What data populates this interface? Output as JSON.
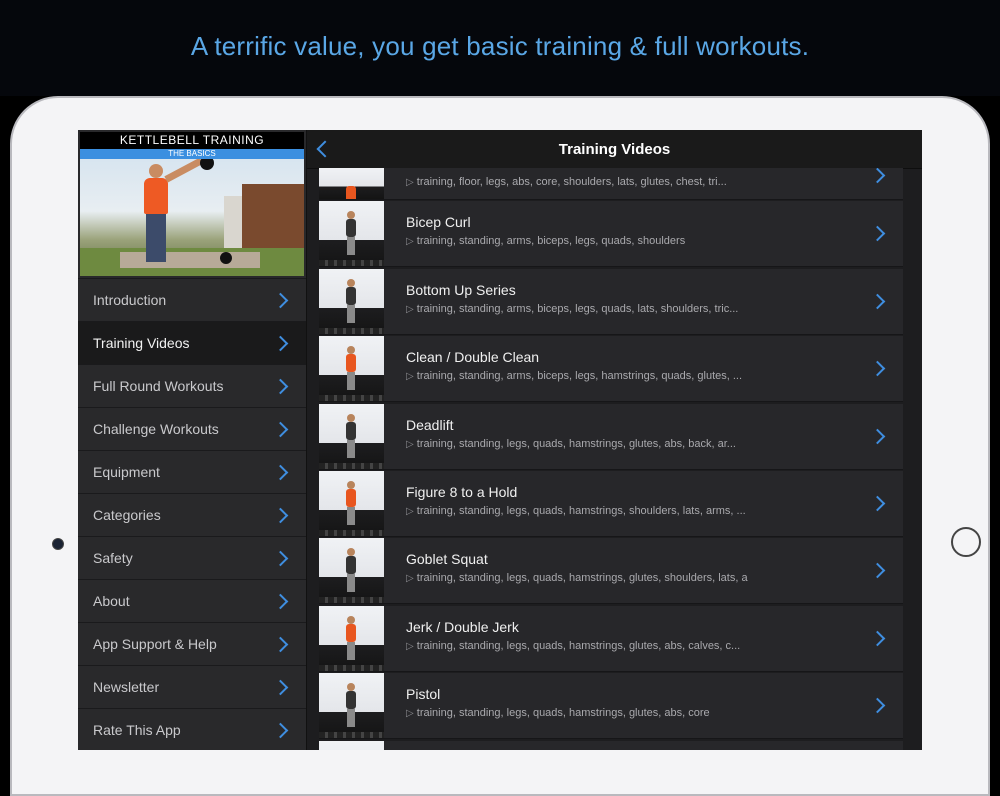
{
  "headline": "A terrific value, you get basic training & full workouts.",
  "app": {
    "hero_title": "KETTLEBELL TRAINING",
    "hero_subtitle": "THE BASICS"
  },
  "sidebar": {
    "items": [
      {
        "label": "Introduction"
      },
      {
        "label": "Training Videos",
        "active": true
      },
      {
        "label": "Full Round Workouts"
      },
      {
        "label": "Challenge Workouts"
      },
      {
        "label": "Equipment"
      },
      {
        "label": "Categories"
      },
      {
        "label": "Safety"
      },
      {
        "label": "About"
      },
      {
        "label": "App Support & Help"
      },
      {
        "label": "Newsletter"
      },
      {
        "label": "Rate This App"
      }
    ]
  },
  "nav": {
    "title": "Training Videos"
  },
  "videos": [
    {
      "title": "",
      "tags": "training, floor, legs, abs, core, shoulders, lats, glutes, chest, tri..."
    },
    {
      "title": "Bicep Curl",
      "tags": "training, standing, arms, biceps, legs, quads, shoulders"
    },
    {
      "title": "Bottom Up Series",
      "tags": "training, standing, arms, biceps, legs, quads, lats, shoulders, tric..."
    },
    {
      "title": "Clean / Double Clean",
      "tags": "training, standing, arms, biceps, legs, hamstrings, quads, glutes, ..."
    },
    {
      "title": "Deadlift",
      "tags": "training, standing, legs, quads, hamstrings, glutes, abs, back, ar..."
    },
    {
      "title": "Figure 8 to a Hold",
      "tags": "training, standing, legs, quads, hamstrings, shoulders, lats, arms, ..."
    },
    {
      "title": "Goblet Squat",
      "tags": "training, standing, legs, quads, hamstrings, glutes, shoulders, lats, a"
    },
    {
      "title": "Jerk / Double Jerk",
      "tags": "training, standing, legs, quads, hamstrings, glutes, abs, calves, c..."
    },
    {
      "title": "Pistol",
      "tags": "training, standing, legs, quads, hamstrings, glutes, abs, core"
    },
    {
      "title": "",
      "tags": ""
    }
  ],
  "colors": {
    "accent": "#3f8ee0",
    "headline": "#5aa7e6"
  }
}
